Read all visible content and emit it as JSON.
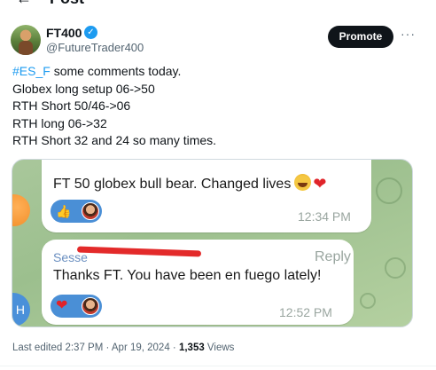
{
  "header": {
    "title": "Post",
    "back_icon": "back-arrow-icon"
  },
  "author": {
    "name": "FT400",
    "handle": "@FutureTrader400",
    "verified": true,
    "promote_label": "Promote",
    "more_icon": "more-icon"
  },
  "tweet": {
    "hashtag": "#ES_F",
    "line1_rest": " some comments today.",
    "lines": [
      "Globex long setup 06->50",
      "RTH Short 50/46->06",
      "RTH long 06->32",
      "RTH Short 32 and 24 so many times."
    ]
  },
  "media": {
    "message1": {
      "text": "FT 50 globex bull bear.  Changed lives",
      "time": "12:34 PM",
      "reaction": "thumbs-up"
    },
    "message2": {
      "sender": "Sesse",
      "reply_label": "Reply",
      "text": "Thanks FT. You have been en fuego lately!",
      "time": "12:52 PM",
      "reaction": "heart"
    },
    "side_avatar_initial": "H"
  },
  "meta": {
    "edited": "Last edited 2:37 PM · Apr 19, 2024 · ",
    "views_count": "1,353",
    "views_label": " Views"
  },
  "colors": {
    "accent": "#1d9bf0",
    "promote_bg": "#0f1419",
    "redaction": "#e32a2a"
  }
}
